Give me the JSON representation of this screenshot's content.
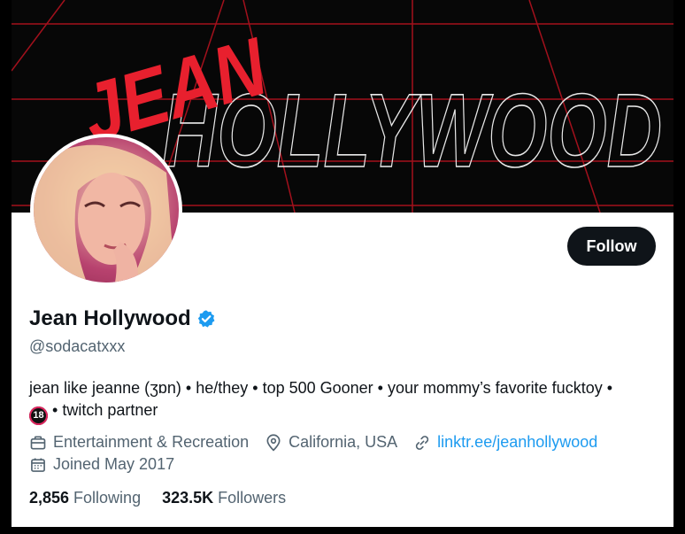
{
  "banner": {
    "logo_word_1": "JEAN",
    "logo_word_2": "HOLLYWOOD"
  },
  "profile": {
    "display_name": "Jean Hollywood",
    "handle": "@sodacatxxx",
    "follow_label": "Follow",
    "bio_line_1": "jean like jeanne (ʒɒn) • he/they • top 500 Gooner • your mommy’s favorite fucktoy •",
    "bio_badge": "18",
    "bio_line_2": "• twitch partner",
    "category": "Entertainment & Recreation",
    "location": "California, USA",
    "website": "linktr.ee/jeanhollywood",
    "joined": "Joined May 2017",
    "following_count": "2,856",
    "following_label": "Following",
    "followers_count": "323.5K",
    "followers_label": "Followers"
  },
  "icons": {
    "verified": "verified-badge-icon",
    "category": "briefcase-icon",
    "location": "location-pin-icon",
    "website": "link-icon",
    "joined": "calendar-icon"
  },
  "colors": {
    "accent": "#1d9bf0",
    "text": "#0f1419",
    "muted": "#536471",
    "banner_red": "#e8202e"
  }
}
